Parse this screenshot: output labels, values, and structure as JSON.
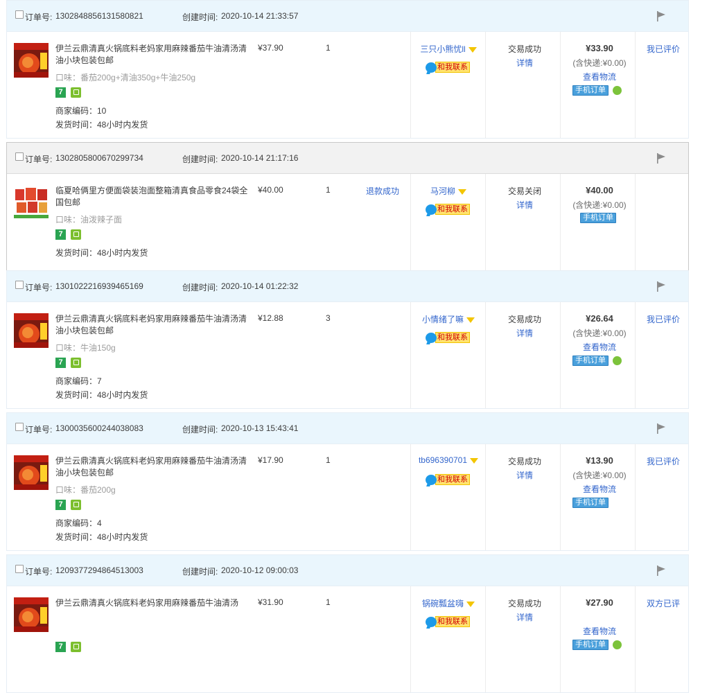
{
  "labels": {
    "order_id_label": "订单号:",
    "created_label": "创建时间:",
    "detail": "详情",
    "logistics": "查看物流",
    "mobile_order": "手机订单",
    "contact": "和我联系"
  },
  "colors": {
    "link": "#3366cc",
    "header_bg": "#eaf6fd",
    "closed_header_bg": "#f2f2f2"
  },
  "orders": [
    {
      "id": "1302848856131580821",
      "created": "2020-10-14 21:33:57",
      "title": "伊兰云鼎清真火锅底料老妈家用麻辣番茄牛油清汤清油小块包装包邮",
      "spec": "口味：番茄200g+清油350g+牛油250g",
      "code": "商家编码：10",
      "ship": "发货时间：48小时内发货",
      "price": "¥37.90",
      "qty": "1",
      "refund": "",
      "seller": "三只小熊忧ll",
      "status": "交易成功",
      "total": "¥33.90",
      "ship_fee": "(含快递:¥0.00)",
      "review": "我已评价",
      "closed": false
    },
    {
      "id": "1302805800670299734",
      "created": "2020-10-14 21:17:16",
      "title": "临夏哈俩里方便面袋装泡面整箱清真食品零食24袋全国包邮",
      "spec": "口味：油泼辣子面",
      "code": "",
      "ship": "发货时间：48小时内发货",
      "price": "¥40.00",
      "qty": "1",
      "refund": "退款成功",
      "seller": "马河柳",
      "status": "交易关闭",
      "total": "¥40.00",
      "ship_fee": "(含快递:¥0.00)",
      "review": "",
      "closed": true
    },
    {
      "id": "1301022216939465169",
      "created": "2020-10-14 01:22:32",
      "title": "伊兰云鼎清真火锅底料老妈家用麻辣番茄牛油清汤清油小块包装包邮",
      "spec": "口味：牛油150g",
      "code": "商家编码：7",
      "ship": "发货时间：48小时内发货",
      "price": "¥12.88",
      "qty": "3",
      "refund": "",
      "seller": "小情绪了嘛",
      "status": "交易成功",
      "total": "¥26.64",
      "ship_fee": "(含快递:¥0.00)",
      "review": "我已评价",
      "closed": false
    },
    {
      "id": "1300035600244038083",
      "created": "2020-10-13 15:43:41",
      "title": "伊兰云鼎清真火锅底料老妈家用麻辣番茄牛油清汤清油小块包装包邮",
      "spec": "口味：番茄200g",
      "code": "商家编码：4",
      "ship": "发货时间：48小时内发货",
      "price": "¥17.90",
      "qty": "1",
      "refund": "",
      "seller": "tb696390701",
      "status": "交易成功",
      "total": "¥13.90",
      "ship_fee": "(含快递:¥0.00)",
      "review": "我已评价",
      "closed": false
    },
    {
      "id": "1209377294864513003",
      "created": "2020-10-12 09:00:03",
      "title": "伊兰云鼎清真火锅底料老妈家用麻辣番茄牛油清汤",
      "spec": "",
      "code": "",
      "ship": "",
      "price": "¥31.90",
      "qty": "1",
      "refund": "",
      "seller": "锅碗瓢盆嗨",
      "status": "交易成功",
      "total": "¥27.90",
      "ship_fee": "",
      "review": "双方已评",
      "closed": false
    }
  ]
}
